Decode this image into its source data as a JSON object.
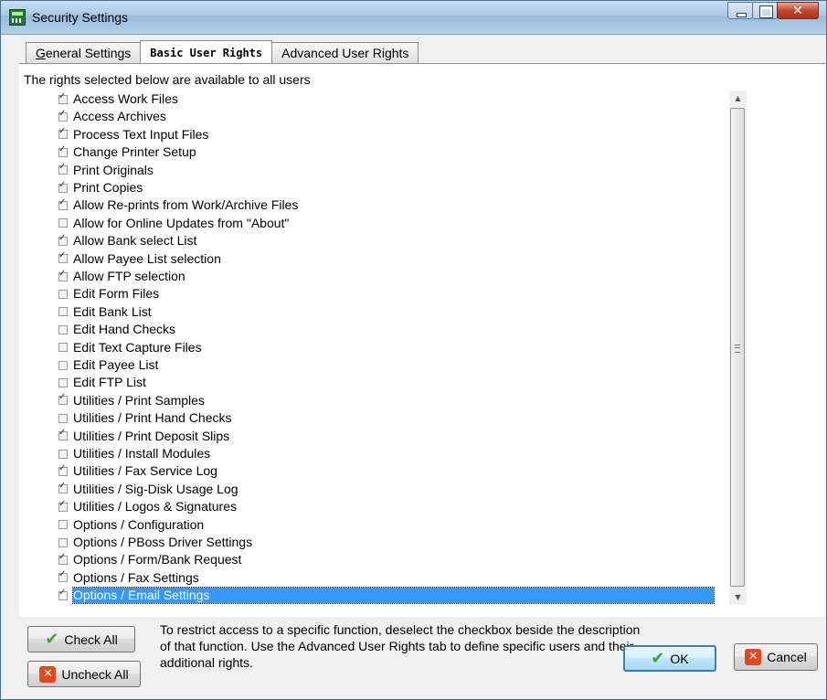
{
  "window": {
    "title": "Security Settings"
  },
  "tabs": [
    {
      "label": "General Settings",
      "accel": "G",
      "rest": "eneral Settings"
    },
    {
      "label": "Basic User Rights"
    },
    {
      "label": "Advanced User Rights"
    }
  ],
  "caption": "The rights selected below are available to all users",
  "rights": [
    {
      "label": "Access Work Files",
      "checked": true
    },
    {
      "label": "Access Archives",
      "checked": true
    },
    {
      "label": "Process Text Input Files",
      "checked": true
    },
    {
      "label": "Change Printer Setup",
      "checked": true
    },
    {
      "label": "Print Originals",
      "checked": true
    },
    {
      "label": "Print Copies",
      "checked": true
    },
    {
      "label": "Allow Re-prints from Work/Archive Files",
      "checked": true
    },
    {
      "label": "Allow for Online Updates from \"About\"",
      "checked": false
    },
    {
      "label": "Allow Bank select List",
      "checked": true
    },
    {
      "label": "Allow Payee List selection",
      "checked": true
    },
    {
      "label": "Allow FTP selection",
      "checked": true
    },
    {
      "label": "Edit Form Files",
      "checked": false
    },
    {
      "label": "Edit Bank List",
      "checked": false
    },
    {
      "label": "Edit Hand Checks",
      "checked": false
    },
    {
      "label": "Edit Text Capture Files",
      "checked": false
    },
    {
      "label": "Edit Payee List",
      "checked": false
    },
    {
      "label": "Edit FTP List",
      "checked": false
    },
    {
      "label": "Utilities / Print Samples",
      "checked": true
    },
    {
      "label": "Utilities / Print Hand Checks",
      "checked": false
    },
    {
      "label": "Utilities / Print Deposit Slips",
      "checked": true
    },
    {
      "label": "Utilities / Install Modules",
      "checked": false
    },
    {
      "label": "Utilities / Fax Service Log",
      "checked": true
    },
    {
      "label": "Utilities / Sig-Disk Usage Log",
      "checked": true
    },
    {
      "label": "Utilities / Logos & Signatures",
      "checked": true
    },
    {
      "label": "Options / Configuration",
      "checked": false
    },
    {
      "label": "Options / PBoss Driver Settings",
      "checked": false
    },
    {
      "label": "Options / Form/Bank Request",
      "checked": true
    },
    {
      "label": "Options / Fax Settings",
      "checked": true
    },
    {
      "label": "Options / Email Settings",
      "checked": true,
      "selected": true
    }
  ],
  "buttons": {
    "check_all": "Check All",
    "uncheck_all": "Uncheck All",
    "ok": "OK",
    "cancel": "Cancel"
  },
  "help_text": "To restrict access to a specific function, deselect the checkbox beside the description of that function. Use the Advanced User Rights tab to define specific users and their additional rights."
}
